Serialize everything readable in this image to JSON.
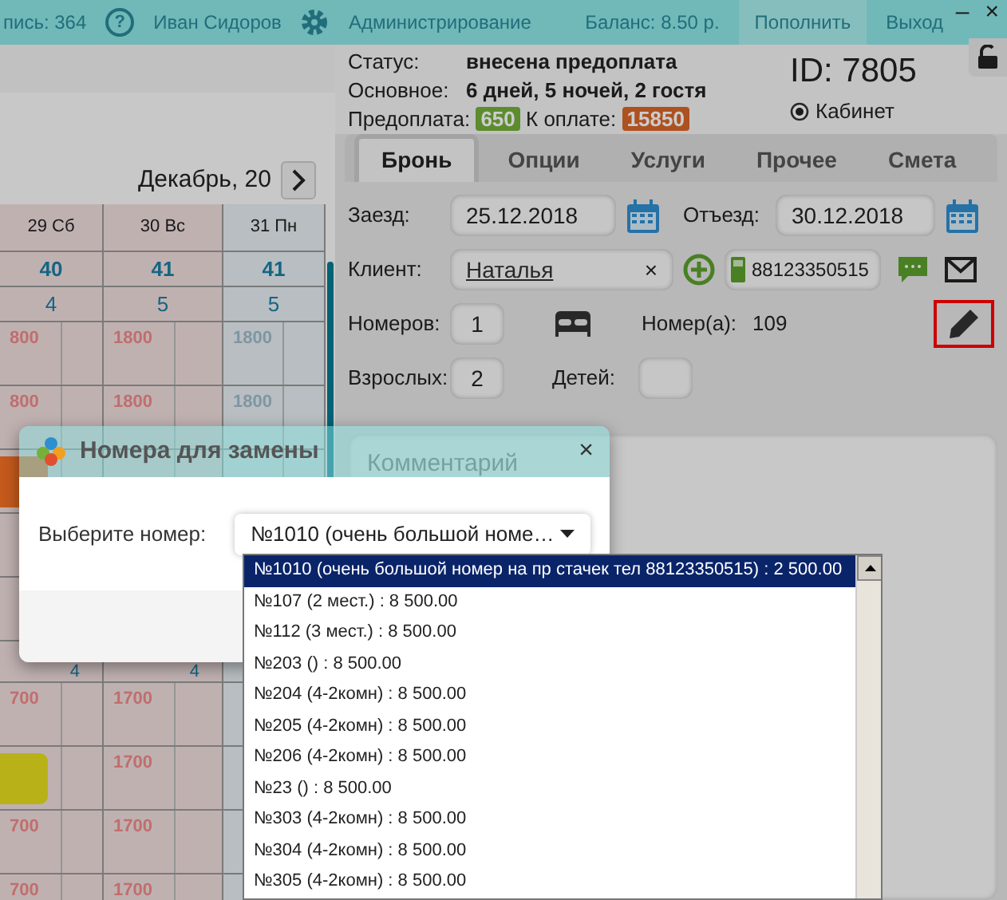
{
  "top_bar": {
    "records": "пись: 364",
    "help": "?",
    "user": "Иван Сидоров",
    "admin": "Администрирование",
    "balance": "Баланс: 8.50 р.",
    "top_up": "Пополнить",
    "logout": "Выход",
    "minimize": "–",
    "close": "×"
  },
  "calendar": {
    "month": "Декабрь, 20",
    "columns": [
      {
        "day": "29 Сб",
        "weekend": true,
        "count": "40",
        "free": "4"
      },
      {
        "day": "30 Вс",
        "weekend": true,
        "count": "41",
        "free": "5"
      },
      {
        "day": "31 Пн",
        "weekend": false,
        "count": "41",
        "free": "5"
      }
    ],
    "rows": [
      {
        "kind": "price",
        "cells": [
          {
            "price": "800"
          },
          {
            "price": "1800"
          },
          {
            "price": "1800"
          }
        ]
      },
      {
        "kind": "price",
        "cells": [
          {
            "price": "800"
          },
          {
            "price": "1800"
          },
          {
            "price": "1800"
          }
        ]
      },
      {
        "kind": "price",
        "cells": [
          {
            "color": "#c45a1c"
          },
          {},
          {}
        ]
      },
      {
        "kind": "price",
        "cells": [
          {},
          {},
          {}
        ]
      },
      {
        "kind": "price",
        "cells": [
          {},
          {},
          {}
        ]
      },
      {
        "kind": "count",
        "cells": [
          {
            "price": "4"
          },
          {
            "price": "4"
          },
          {}
        ]
      },
      {
        "kind": "price",
        "cells": [
          {
            "price": "700"
          },
          {
            "price": "1700"
          },
          {}
        ]
      },
      {
        "kind": "price",
        "cells": [
          {
            "color": "#b8b218"
          },
          {
            "price": "1700"
          },
          {}
        ]
      },
      {
        "kind": "price",
        "cells": [
          {
            "price": "700"
          },
          {
            "price": "1700"
          },
          {}
        ]
      },
      {
        "kind": "price",
        "cells": [
          {
            "price": "700"
          },
          {
            "price": "1700"
          },
          {}
        ]
      }
    ]
  },
  "booking": {
    "status_label": "Статус:",
    "status": "внесена предоплата",
    "main_label": "Основное:",
    "main": "6 дней, 5 ночей, 2 гостя",
    "prepay_label": "Предоплата:",
    "prepay": "650",
    "due_label": "К оплате:",
    "due": "15850",
    "id": "ID: 7805",
    "cabinet": {
      "label": "Кабинет",
      "checked": true
    }
  },
  "tabs": [
    {
      "label": "Бронь",
      "selected": true
    },
    {
      "label": "Опции",
      "selected": false
    },
    {
      "label": "Услуги",
      "selected": false
    },
    {
      "label": "Прочее",
      "selected": false
    },
    {
      "label": "Смета",
      "selected": false
    }
  ],
  "form": {
    "checkin_label": "Заезд:",
    "checkin": "25.12.2018",
    "checkout_label": "Отъезд:",
    "checkout": "30.12.2018",
    "client_label": "Клиент:",
    "client": "Наталья",
    "clear": "×",
    "phone": "88123350515",
    "rooms_label": "Номеров:",
    "rooms": "1",
    "room_no_label": "Номер(а):",
    "room_no": "109",
    "edit_highlighted": true,
    "adults_label": "Взрослых:",
    "adults": "2",
    "children_label": "Детей:",
    "comment_placeholder": "Комментарий"
  },
  "modal": {
    "title": "Номера для замены",
    "close": "×",
    "select_label": "Выберите номер:",
    "select_value": "№1010 (очень большой номе…",
    "options": [
      {
        "text": "№1010 (очень большой номер на пр стачек тел 88123350515) : 2 500.00",
        "selected": true
      },
      {
        "text": "№107 (2 мест.) : 8 500.00",
        "selected": false
      },
      {
        "text": "№112 (3 мест.) : 8 500.00",
        "selected": false
      },
      {
        "text": "№203 () : 8 500.00",
        "selected": false
      },
      {
        "text": "№204 (4-2комн) : 8 500.00",
        "selected": false
      },
      {
        "text": "№205 (4-2комн) : 8 500.00",
        "selected": false
      },
      {
        "text": "№206 (4-2комн) : 8 500.00",
        "selected": false
      },
      {
        "text": "№23 () : 8 500.00",
        "selected": false
      },
      {
        "text": "№303 (4-2комн) : 8 500.00",
        "selected": false
      },
      {
        "text": "№304 (4-2комн) : 8 500.00",
        "selected": false
      },
      {
        "text": "№305 (4-2комн) : 8 500.00",
        "selected": false
      }
    ]
  }
}
